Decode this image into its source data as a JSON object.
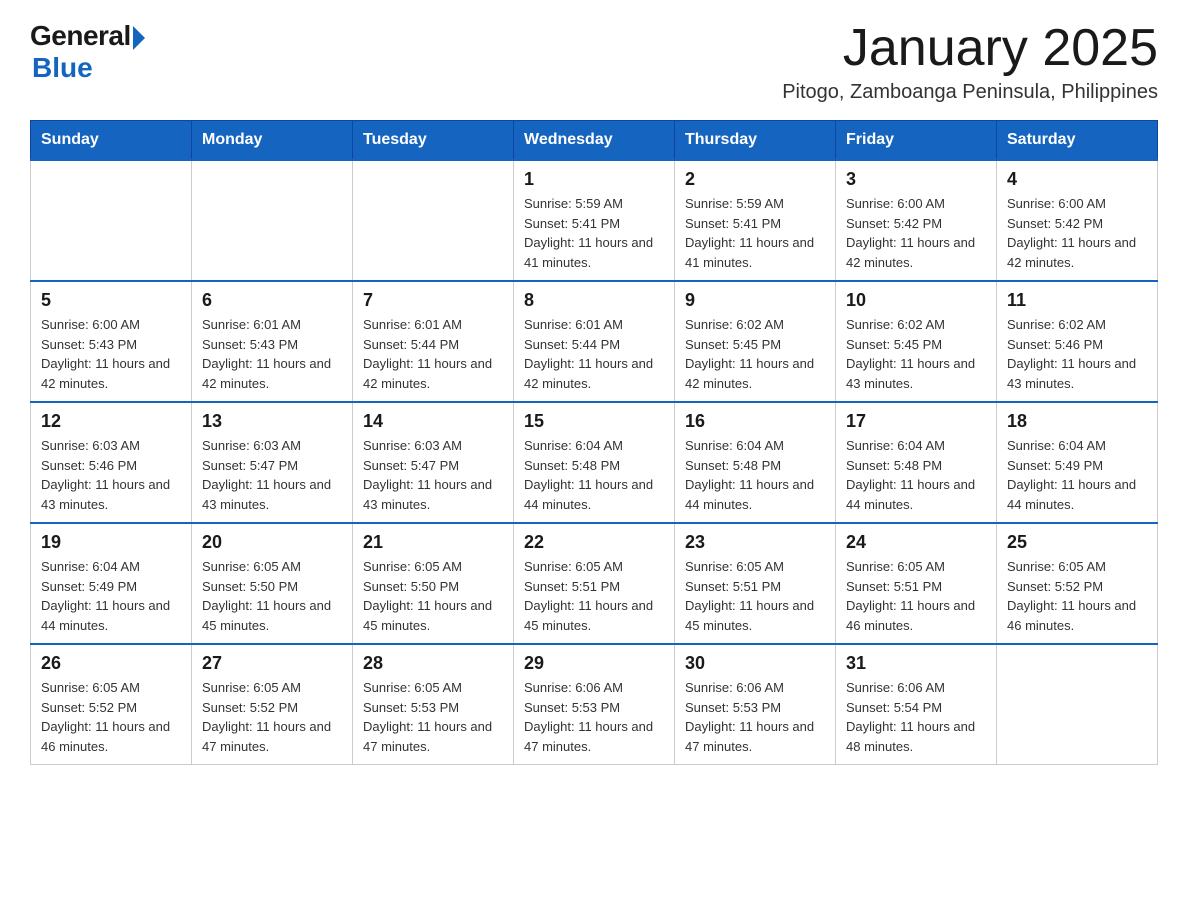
{
  "header": {
    "logo_general": "General",
    "logo_blue": "Blue",
    "title": "January 2025",
    "subtitle": "Pitogo, Zamboanga Peninsula, Philippines"
  },
  "weekdays": [
    "Sunday",
    "Monday",
    "Tuesday",
    "Wednesday",
    "Thursday",
    "Friday",
    "Saturday"
  ],
  "weeks": [
    [
      {
        "day": "",
        "info": ""
      },
      {
        "day": "",
        "info": ""
      },
      {
        "day": "",
        "info": ""
      },
      {
        "day": "1",
        "info": "Sunrise: 5:59 AM\nSunset: 5:41 PM\nDaylight: 11 hours and 41 minutes."
      },
      {
        "day": "2",
        "info": "Sunrise: 5:59 AM\nSunset: 5:41 PM\nDaylight: 11 hours and 41 minutes."
      },
      {
        "day": "3",
        "info": "Sunrise: 6:00 AM\nSunset: 5:42 PM\nDaylight: 11 hours and 42 minutes."
      },
      {
        "day": "4",
        "info": "Sunrise: 6:00 AM\nSunset: 5:42 PM\nDaylight: 11 hours and 42 minutes."
      }
    ],
    [
      {
        "day": "5",
        "info": "Sunrise: 6:00 AM\nSunset: 5:43 PM\nDaylight: 11 hours and 42 minutes."
      },
      {
        "day": "6",
        "info": "Sunrise: 6:01 AM\nSunset: 5:43 PM\nDaylight: 11 hours and 42 minutes."
      },
      {
        "day": "7",
        "info": "Sunrise: 6:01 AM\nSunset: 5:44 PM\nDaylight: 11 hours and 42 minutes."
      },
      {
        "day": "8",
        "info": "Sunrise: 6:01 AM\nSunset: 5:44 PM\nDaylight: 11 hours and 42 minutes."
      },
      {
        "day": "9",
        "info": "Sunrise: 6:02 AM\nSunset: 5:45 PM\nDaylight: 11 hours and 42 minutes."
      },
      {
        "day": "10",
        "info": "Sunrise: 6:02 AM\nSunset: 5:45 PM\nDaylight: 11 hours and 43 minutes."
      },
      {
        "day": "11",
        "info": "Sunrise: 6:02 AM\nSunset: 5:46 PM\nDaylight: 11 hours and 43 minutes."
      }
    ],
    [
      {
        "day": "12",
        "info": "Sunrise: 6:03 AM\nSunset: 5:46 PM\nDaylight: 11 hours and 43 minutes."
      },
      {
        "day": "13",
        "info": "Sunrise: 6:03 AM\nSunset: 5:47 PM\nDaylight: 11 hours and 43 minutes."
      },
      {
        "day": "14",
        "info": "Sunrise: 6:03 AM\nSunset: 5:47 PM\nDaylight: 11 hours and 43 minutes."
      },
      {
        "day": "15",
        "info": "Sunrise: 6:04 AM\nSunset: 5:48 PM\nDaylight: 11 hours and 44 minutes."
      },
      {
        "day": "16",
        "info": "Sunrise: 6:04 AM\nSunset: 5:48 PM\nDaylight: 11 hours and 44 minutes."
      },
      {
        "day": "17",
        "info": "Sunrise: 6:04 AM\nSunset: 5:48 PM\nDaylight: 11 hours and 44 minutes."
      },
      {
        "day": "18",
        "info": "Sunrise: 6:04 AM\nSunset: 5:49 PM\nDaylight: 11 hours and 44 minutes."
      }
    ],
    [
      {
        "day": "19",
        "info": "Sunrise: 6:04 AM\nSunset: 5:49 PM\nDaylight: 11 hours and 44 minutes."
      },
      {
        "day": "20",
        "info": "Sunrise: 6:05 AM\nSunset: 5:50 PM\nDaylight: 11 hours and 45 minutes."
      },
      {
        "day": "21",
        "info": "Sunrise: 6:05 AM\nSunset: 5:50 PM\nDaylight: 11 hours and 45 minutes."
      },
      {
        "day": "22",
        "info": "Sunrise: 6:05 AM\nSunset: 5:51 PM\nDaylight: 11 hours and 45 minutes."
      },
      {
        "day": "23",
        "info": "Sunrise: 6:05 AM\nSunset: 5:51 PM\nDaylight: 11 hours and 45 minutes."
      },
      {
        "day": "24",
        "info": "Sunrise: 6:05 AM\nSunset: 5:51 PM\nDaylight: 11 hours and 46 minutes."
      },
      {
        "day": "25",
        "info": "Sunrise: 6:05 AM\nSunset: 5:52 PM\nDaylight: 11 hours and 46 minutes."
      }
    ],
    [
      {
        "day": "26",
        "info": "Sunrise: 6:05 AM\nSunset: 5:52 PM\nDaylight: 11 hours and 46 minutes."
      },
      {
        "day": "27",
        "info": "Sunrise: 6:05 AM\nSunset: 5:52 PM\nDaylight: 11 hours and 47 minutes."
      },
      {
        "day": "28",
        "info": "Sunrise: 6:05 AM\nSunset: 5:53 PM\nDaylight: 11 hours and 47 minutes."
      },
      {
        "day": "29",
        "info": "Sunrise: 6:06 AM\nSunset: 5:53 PM\nDaylight: 11 hours and 47 minutes."
      },
      {
        "day": "30",
        "info": "Sunrise: 6:06 AM\nSunset: 5:53 PM\nDaylight: 11 hours and 47 minutes."
      },
      {
        "day": "31",
        "info": "Sunrise: 6:06 AM\nSunset: 5:54 PM\nDaylight: 11 hours and 48 minutes."
      },
      {
        "day": "",
        "info": ""
      }
    ]
  ]
}
